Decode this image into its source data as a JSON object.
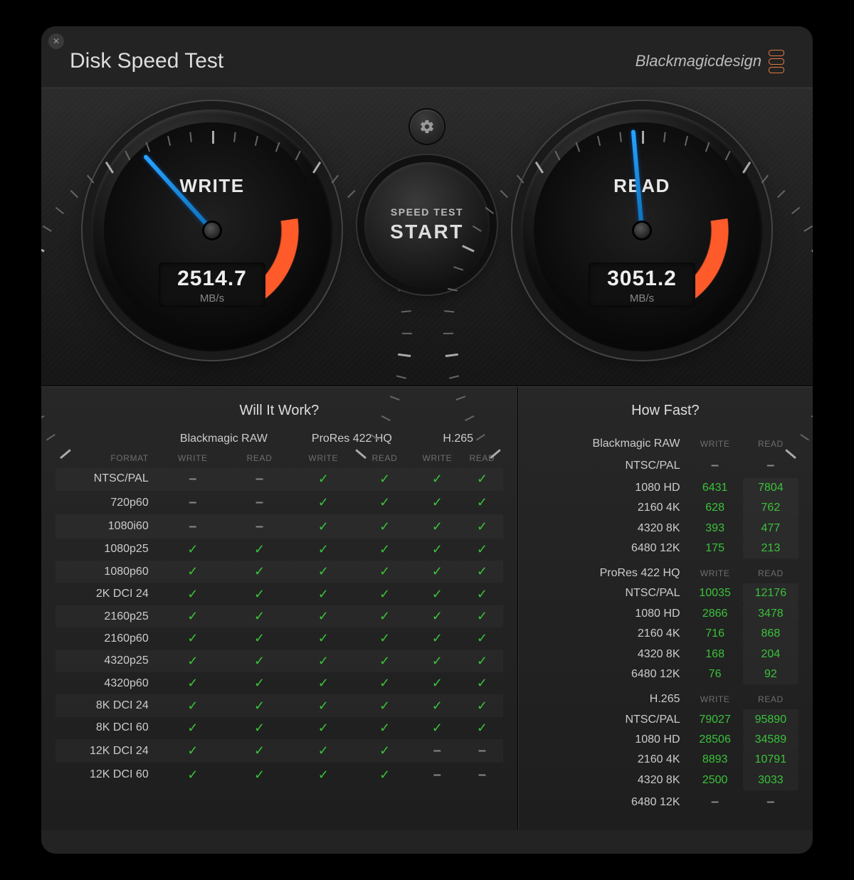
{
  "header": {
    "title": "Disk Speed Test",
    "brand": "Blackmagicdesign"
  },
  "center": {
    "start_line1": "SPEED TEST",
    "start_line2": "START"
  },
  "gauge": {
    "write": {
      "label": "WRITE",
      "value": "2514.7",
      "unit": "MB/s",
      "needle_deg": -42
    },
    "read": {
      "label": "READ",
      "value": "3051.2",
      "unit": "MB/s",
      "needle_deg": -5
    }
  },
  "ww": {
    "title": "Will It Work?",
    "format_label": "FORMAT",
    "write_label": "WRITE",
    "read_label": "READ",
    "codecs": [
      "Blackmagic RAW",
      "ProRes 422 HQ",
      "H.265"
    ],
    "rows": [
      {
        "f": "NTSC/PAL",
        "c": [
          "-",
          "-",
          "y",
          "y",
          "y",
          "y"
        ]
      },
      {
        "f": "720p60",
        "c": [
          "-",
          "-",
          "y",
          "y",
          "y",
          "y"
        ]
      },
      {
        "f": "1080i60",
        "c": [
          "-",
          "-",
          "y",
          "y",
          "y",
          "y"
        ]
      },
      {
        "f": "1080p25",
        "c": [
          "y",
          "y",
          "y",
          "y",
          "y",
          "y"
        ]
      },
      {
        "f": "1080p60",
        "c": [
          "y",
          "y",
          "y",
          "y",
          "y",
          "y"
        ]
      },
      {
        "f": "2K DCI 24",
        "c": [
          "y",
          "y",
          "y",
          "y",
          "y",
          "y"
        ]
      },
      {
        "f": "2160p25",
        "c": [
          "y",
          "y",
          "y",
          "y",
          "y",
          "y"
        ]
      },
      {
        "f": "2160p60",
        "c": [
          "y",
          "y",
          "y",
          "y",
          "y",
          "y"
        ]
      },
      {
        "f": "4320p25",
        "c": [
          "y",
          "y",
          "y",
          "y",
          "y",
          "y"
        ]
      },
      {
        "f": "4320p60",
        "c": [
          "y",
          "y",
          "y",
          "y",
          "y",
          "y"
        ]
      },
      {
        "f": "8K DCI 24",
        "c": [
          "y",
          "y",
          "y",
          "y",
          "y",
          "y"
        ]
      },
      {
        "f": "8K DCI 60",
        "c": [
          "y",
          "y",
          "y",
          "y",
          "y",
          "y"
        ]
      },
      {
        "f": "12K DCI 24",
        "c": [
          "y",
          "y",
          "y",
          "y",
          "-",
          "-"
        ]
      },
      {
        "f": "12K DCI 60",
        "c": [
          "y",
          "y",
          "y",
          "y",
          "-",
          "-"
        ]
      }
    ]
  },
  "hf": {
    "title": "How Fast?",
    "write_label": "WRITE",
    "read_label": "READ",
    "sections": [
      {
        "name": "Blackmagic RAW",
        "rows": [
          {
            "f": "NTSC/PAL",
            "w": "-",
            "r": "-"
          },
          {
            "f": "1080 HD",
            "w": "6431",
            "r": "7804"
          },
          {
            "f": "2160 4K",
            "w": "628",
            "r": "762"
          },
          {
            "f": "4320 8K",
            "w": "393",
            "r": "477"
          },
          {
            "f": "6480 12K",
            "w": "175",
            "r": "213"
          }
        ]
      },
      {
        "name": "ProRes 422 HQ",
        "rows": [
          {
            "f": "NTSC/PAL",
            "w": "10035",
            "r": "12176"
          },
          {
            "f": "1080 HD",
            "w": "2866",
            "r": "3478"
          },
          {
            "f": "2160 4K",
            "w": "716",
            "r": "868"
          },
          {
            "f": "4320 8K",
            "w": "168",
            "r": "204"
          },
          {
            "f": "6480 12K",
            "w": "76",
            "r": "92"
          }
        ]
      },
      {
        "name": "H.265",
        "rows": [
          {
            "f": "NTSC/PAL",
            "w": "79027",
            "r": "95890"
          },
          {
            "f": "1080 HD",
            "w": "28506",
            "r": "34589"
          },
          {
            "f": "2160 4K",
            "w": "8893",
            "r": "10791"
          },
          {
            "f": "4320 8K",
            "w": "2500",
            "r": "3033"
          },
          {
            "f": "6480 12K",
            "w": "-",
            "r": "-"
          }
        ]
      }
    ]
  }
}
